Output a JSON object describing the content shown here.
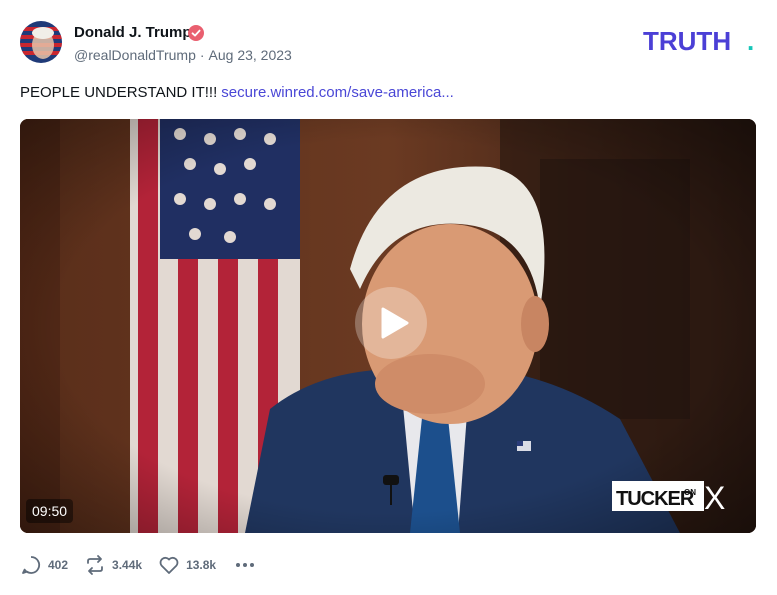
{
  "author": {
    "display_name": "Donald J. Trump",
    "handle": "@realDonaldTrump",
    "separator": "·",
    "date": "Aug 23, 2023",
    "verified_color": "#e95f6f"
  },
  "brand": {
    "logo_text": "TRUTH",
    "logo_dot": ".",
    "logo_color": "#4b3fd6",
    "dot_color": "#15c6b8"
  },
  "post": {
    "text": "PEOPLE UNDERSTAND IT!!!",
    "link_text": "secure.winred.com/save-america...",
    "link_color": "#4a47d6"
  },
  "video": {
    "duration": "09:50",
    "watermark_text": "TUCKER",
    "watermark_small": "ON",
    "watermark_x": "X"
  },
  "actions": {
    "replies": "402",
    "reposts": "3.44k",
    "likes": "13.8k",
    "icons": [
      "reply-icon",
      "repost-icon",
      "heart-icon",
      "more-icon"
    ]
  }
}
